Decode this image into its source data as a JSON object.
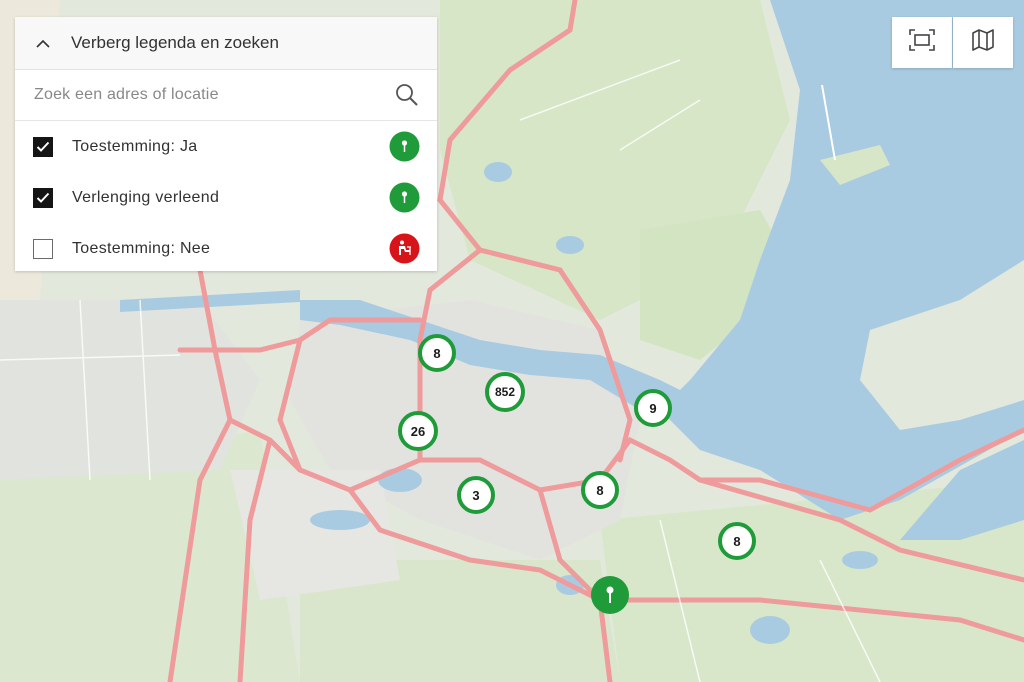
{
  "legend": {
    "toggle_label": "Verberg legenda en zoeken",
    "search_placeholder": "Zoek een adres of locatie",
    "items": [
      {
        "label": "Toestemming: Ja",
        "checked": true,
        "symbol_color": "#1f9b3a",
        "symbol": "pin-icon"
      },
      {
        "label": "Verlenging verleend",
        "checked": true,
        "symbol_color": "#1f9b3a",
        "symbol": "pin-icon"
      },
      {
        "label": "Toestemming: Nee",
        "checked": false,
        "symbol_color": "#d7141a",
        "symbol": "person-icon"
      }
    ]
  },
  "toolbar": {
    "fullscreen_icon": "fullscreen-icon",
    "basemap_icon": "map-icon"
  },
  "clusters": [
    {
      "count": "8"
    },
    {
      "count": "852"
    },
    {
      "count": "9"
    },
    {
      "count": "26"
    },
    {
      "count": "3"
    },
    {
      "count": "8"
    },
    {
      "count": "8"
    }
  ],
  "colors": {
    "cluster_ring": "#1f9b3a",
    "water": "#a9cbe1",
    "land": "#dbe7cf",
    "motorway": "#ef9a9b"
  }
}
